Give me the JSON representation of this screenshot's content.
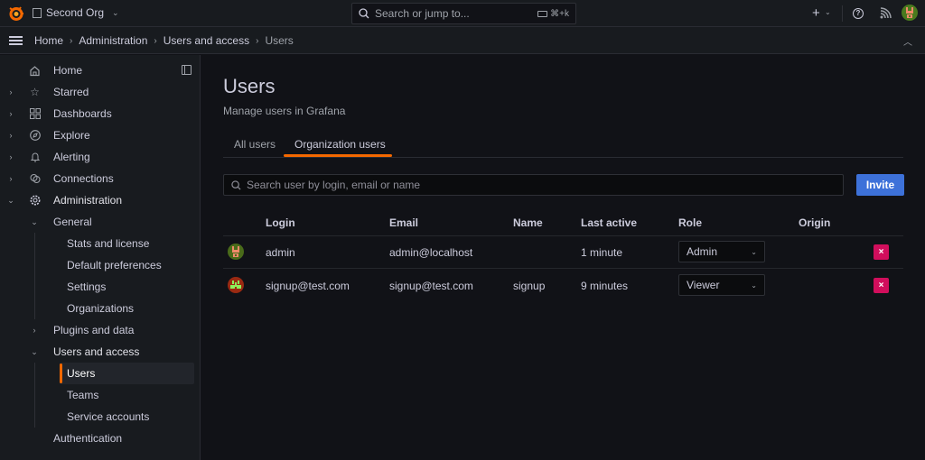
{
  "topbar": {
    "org_name": "Second Org",
    "search_placeholder": "Search or jump to...",
    "search_shortcut": "⌘+k",
    "plus_label": "+",
    "help_label": "?"
  },
  "breadcrumb": [
    {
      "label": "Home"
    },
    {
      "label": "Administration"
    },
    {
      "label": "Users and access"
    },
    {
      "label": "Users"
    }
  ],
  "breadcrumb_sep": "›",
  "sidebar": {
    "items": [
      {
        "label": "Home",
        "icon": "home-icon"
      },
      {
        "label": "Starred",
        "icon": "star-icon"
      },
      {
        "label": "Dashboards",
        "icon": "dashboards-icon"
      },
      {
        "label": "Explore",
        "icon": "compass-icon"
      },
      {
        "label": "Alerting",
        "icon": "bell-icon"
      },
      {
        "label": "Connections",
        "icon": "connections-icon"
      },
      {
        "label": "Administration",
        "icon": "gear-icon"
      }
    ],
    "admin_children": {
      "general": "General",
      "general_items": [
        "Stats and license",
        "Default preferences",
        "Settings",
        "Organizations"
      ],
      "plugins": "Plugins and data",
      "users_access": "Users and access",
      "users_access_items": [
        "Users",
        "Teams",
        "Service accounts"
      ],
      "authentication": "Authentication"
    }
  },
  "page": {
    "title": "Users",
    "subtitle": "Manage users in Grafana",
    "tabs": [
      {
        "label": "All users",
        "active": false
      },
      {
        "label": "Organization users",
        "active": true
      }
    ],
    "search_placeholder": "Search user by login, email or name",
    "invite_label": "Invite"
  },
  "table": {
    "headers": [
      "Login",
      "Email",
      "Name",
      "Last active",
      "Role",
      "Origin"
    ],
    "rows": [
      {
        "login": "admin",
        "email": "admin@localhost",
        "name": "",
        "last_active": "1 minute",
        "role": "Admin",
        "origin": ""
      },
      {
        "login": "signup@test.com",
        "email": "signup@test.com",
        "name": "signup",
        "last_active": "9 minutes",
        "role": "Viewer",
        "origin": ""
      }
    ],
    "delete_label": "×"
  },
  "colors": {
    "accent": "#f46800",
    "primary": "#3d71d9",
    "danger": "#d10e5c"
  }
}
